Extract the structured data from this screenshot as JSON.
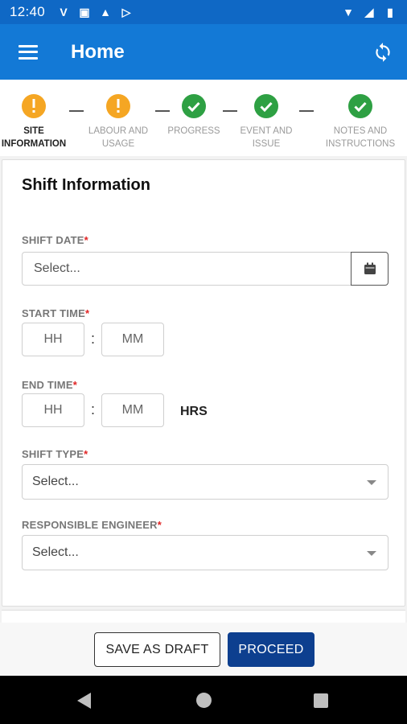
{
  "status_bar": {
    "time": "12:40",
    "left_icons": [
      "v-icon",
      "sim-alert-icon",
      "warning-icon",
      "play-store-icon"
    ],
    "left_glyphs": [
      "V",
      "▣",
      "▲",
      "▷"
    ],
    "right_icons": [
      "wifi-icon",
      "signal-icon",
      "battery-icon"
    ],
    "right_glyphs": [
      "▼",
      "◢",
      "▮"
    ]
  },
  "app_bar": {
    "title": "Home",
    "color": "#1379d6"
  },
  "stepper": {
    "steps": [
      {
        "label_line1": "SITE",
        "label_line2": "INFORMATION",
        "status": "warning",
        "active": true
      },
      {
        "label_line1": "LABOUR AND",
        "label_line2": "USAGE",
        "status": "warning",
        "active": false
      },
      {
        "label_line1": "PROGRESS",
        "label_line2": "",
        "status": "complete",
        "active": false
      },
      {
        "label_line1": "EVENT AND",
        "label_line2": "ISSUE",
        "status": "complete",
        "active": false
      },
      {
        "label_line1": "NOTES AND",
        "label_line2": "INSTRUCTIONS",
        "status": "complete",
        "active": false
      }
    ],
    "colors": {
      "warning": "#f5a623",
      "complete": "#2ea043"
    }
  },
  "form": {
    "title": "Shift Information",
    "required_marker": "*",
    "shift_date": {
      "label": "SHIFT DATE",
      "placeholder": "Select..."
    },
    "start_time": {
      "label": "START TIME",
      "hh_placeholder": "HH",
      "mm_placeholder": "MM",
      "separator": ":"
    },
    "end_time": {
      "label": "END TIME",
      "hh_placeholder": "HH",
      "mm_placeholder": "MM",
      "separator": ":",
      "suffix": "HRS"
    },
    "shift_type": {
      "label": "SHIFT TYPE",
      "selected": "Select..."
    },
    "responsible_engineer": {
      "label": "RESPONSIBLE ENGINEER",
      "selected": "Select..."
    }
  },
  "actions": {
    "save_draft_label": "SAVE AS DRAFT",
    "proceed_label": "PROCEED",
    "proceed_color": "#0d3f8f"
  }
}
